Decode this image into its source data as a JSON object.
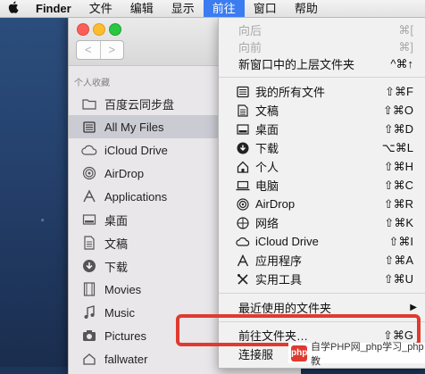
{
  "menubar": {
    "apple_icon": "apple-logo-icon",
    "items": [
      "Finder",
      "文件",
      "编辑",
      "显示",
      "前往",
      "窗口",
      "帮助"
    ],
    "active_index": 4
  },
  "finder": {
    "nav_back": "<",
    "nav_forward": ">",
    "sidebar_header": "个人收藏",
    "sidebar_items": [
      {
        "label": "百度云同步盘",
        "icon": "folder-icon"
      },
      {
        "label": "All My Files",
        "icon": "all-files-icon",
        "selected": true
      },
      {
        "label": "iCloud Drive",
        "icon": "cloud-icon"
      },
      {
        "label": "AirDrop",
        "icon": "airdrop-icon"
      },
      {
        "label": "Applications",
        "icon": "applications-icon"
      },
      {
        "label": "桌面",
        "icon": "desktop-icon"
      },
      {
        "label": "文稿",
        "icon": "document-icon"
      },
      {
        "label": "下载",
        "icon": "download-icon"
      },
      {
        "label": "Movies",
        "icon": "movies-icon"
      },
      {
        "label": "Music",
        "icon": "music-icon"
      },
      {
        "label": "Pictures",
        "icon": "camera-icon"
      },
      {
        "label": "fallwater",
        "icon": "home-icon"
      }
    ]
  },
  "go_menu": {
    "items": [
      {
        "label": "向后",
        "shortcut": "⌘[",
        "disabled": true
      },
      {
        "label": "向前",
        "shortcut": "⌘]",
        "disabled": true
      },
      {
        "label": "新窗口中的上层文件夹",
        "shortcut": "^⌘↑"
      },
      {
        "label": "我的所有文件",
        "shortcut": "⇧⌘F",
        "icon": "all-files-icon"
      },
      {
        "label": "文稿",
        "shortcut": "⇧⌘O",
        "icon": "document-icon"
      },
      {
        "label": "桌面",
        "shortcut": "⇧⌘D",
        "icon": "desktop-icon"
      },
      {
        "label": "下载",
        "shortcut": "⌥⌘L",
        "icon": "download-icon"
      },
      {
        "label": "个人",
        "shortcut": "⇧⌘H",
        "icon": "home-icon"
      },
      {
        "label": "电脑",
        "shortcut": "⇧⌘C",
        "icon": "computer-icon"
      },
      {
        "label": "AirDrop",
        "shortcut": "⇧⌘R",
        "icon": "airdrop-icon"
      },
      {
        "label": "网络",
        "shortcut": "⇧⌘K",
        "icon": "network-icon"
      },
      {
        "label": "iCloud Drive",
        "shortcut": "⇧⌘I",
        "icon": "cloud-icon"
      },
      {
        "label": "应用程序",
        "shortcut": "⇧⌘A",
        "icon": "applications-icon"
      },
      {
        "label": "实用工具",
        "shortcut": "⇧⌘U",
        "icon": "utilities-icon"
      },
      {
        "label": "最近使用的文件夹",
        "submenu": true
      },
      {
        "label": "前往文件夹…",
        "shortcut": "⇧⌘G"
      },
      {
        "label": "连接服"
      }
    ]
  },
  "watermark": {
    "logo": "php",
    "text": "自学PHP网_php学习_php教"
  },
  "colors": {
    "highlight": "#e03a30",
    "active_menu": "#3b7cf0"
  }
}
